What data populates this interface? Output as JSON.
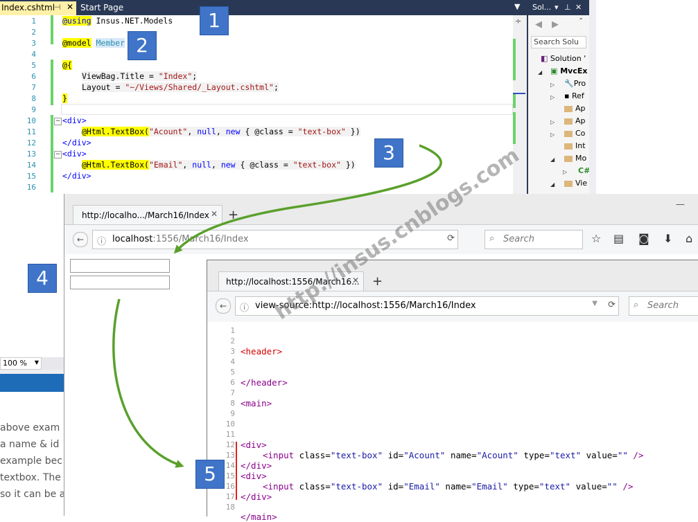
{
  "vs": {
    "tabs": [
      {
        "label": "Index.cshtml",
        "active": true
      },
      {
        "label": "Start Page",
        "active": false
      }
    ],
    "code_lines": [
      {
        "n": "1"
      },
      {
        "n": "2"
      },
      {
        "n": "3"
      },
      {
        "n": "4"
      },
      {
        "n": "5"
      },
      {
        "n": "6"
      },
      {
        "n": "7"
      },
      {
        "n": "8"
      },
      {
        "n": "9"
      },
      {
        "n": "10"
      },
      {
        "n": "11"
      },
      {
        "n": "12"
      },
      {
        "n": "13"
      },
      {
        "n": "14"
      },
      {
        "n": "15"
      },
      {
        "n": "16"
      }
    ],
    "code": {
      "l1_kw": "@using",
      "l1_rest": " Insus.NET.Models",
      "l3_kw": "@model",
      "l3_type": "Member",
      "l5": "@{",
      "l6_a": "ViewBag.Title = ",
      "l6_s": "\"Index\"",
      "l6_b": ";",
      "l7_a": "Layout = ",
      "l7_s": "\"~/Views/Shared/_Layout.cshtml\"",
      "l7_b": ";",
      "l8": "}",
      "l10": "<div>",
      "l11_a": "@Html.TextBox(",
      "l11_s1": "\"Acount\"",
      "l11_b": ", ",
      "l11_k1": "null",
      "l11_c": ", ",
      "l11_k2": "new",
      "l11_d": " { @class = ",
      "l11_s2": "\"text-box\"",
      "l11_e": " })",
      "l12": "</div>",
      "l13": "<div>",
      "l14_a": "@Html.TextBox(",
      "l14_s1": "\"Email\"",
      "l14_b": ", ",
      "l14_k1": "null",
      "l14_c": ", ",
      "l14_k2": "new",
      "l14_d": " { @class = ",
      "l14_s2": "\"text-box\"",
      "l14_e": " })",
      "l15": "</div>"
    },
    "zoom": "100 %"
  },
  "solution_explorer": {
    "title": "Sol...",
    "search_placeholder": "Search Solu",
    "items": [
      {
        "label": "Solution '"
      },
      {
        "label": "MvcEx"
      },
      {
        "label": "Pro"
      },
      {
        "label": "Ref"
      },
      {
        "label": "Ap"
      },
      {
        "label": "Ap"
      },
      {
        "label": "Co"
      },
      {
        "label": "Int"
      },
      {
        "label": "Mo"
      },
      {
        "label": "C#"
      },
      {
        "label": "Vie"
      }
    ]
  },
  "blog": {
    "lines": [
      "above exam",
      "a name & id",
      "example bec",
      "textbox. The",
      "so it can be a"
    ]
  },
  "browser1": {
    "tab_title": "http://localho.../March16/Index",
    "url_host": "localhost",
    "url_rest": ":1556/March16/Index",
    "search_placeholder": "Search"
  },
  "browser2": {
    "tab_title": "http://localhost:1556/March16...",
    "url": "view-source:http://localhost:1556/March16/Index",
    "search_placeholder": "Search",
    "source_lines": [
      {
        "n": "1"
      },
      {
        "n": "2"
      },
      {
        "n": "3"
      },
      {
        "n": "4"
      },
      {
        "n": "5"
      },
      {
        "n": "6"
      },
      {
        "n": "7"
      },
      {
        "n": "8"
      },
      {
        "n": "9"
      },
      {
        "n": "10"
      },
      {
        "n": "11"
      },
      {
        "n": "12"
      },
      {
        "n": "13"
      },
      {
        "n": "14"
      },
      {
        "n": "15"
      },
      {
        "n": "16"
      },
      {
        "n": "17"
      },
      {
        "n": "18"
      }
    ],
    "source": {
      "header_open": "<header>",
      "header_close": "</header>",
      "main_open": "<main>",
      "div_open": "<div>",
      "div_close": "</div>",
      "input_open": "<input",
      "a_class": " class=",
      "v_class": "\"text-box\"",
      "a_id": " id=",
      "v_id1": "\"Acount\"",
      "v_id2": "\"Email\"",
      "a_name": " name=",
      "a_type": " type=",
      "v_type": "\"text\"",
      "a_value": " value=",
      "v_value": "\"\"",
      "self_close": " />",
      "main_close": "</main>"
    }
  },
  "badges": [
    "1",
    "2",
    "3",
    "4",
    "5"
  ],
  "watermark": "http://insus.cnblogs.com",
  "colors": {
    "accent": "#3f74c8",
    "arrow": "#5aa02c",
    "vs_chrome": "#293955"
  }
}
